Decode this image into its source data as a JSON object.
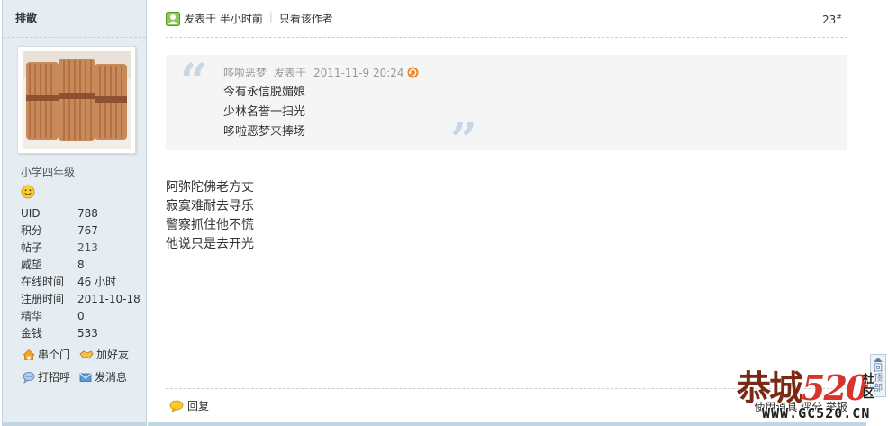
{
  "author": {
    "name": "排散",
    "group": "小学四年级",
    "stats": [
      {
        "label": "UID",
        "value": "788"
      },
      {
        "label": "积分",
        "value": "767"
      },
      {
        "label": "帖子",
        "value": "213"
      },
      {
        "label": "威望",
        "value": "8"
      },
      {
        "label": "在线时间",
        "value": "46 小时"
      },
      {
        "label": "注册时间",
        "value": "2011-10-18"
      },
      {
        "label": "精华",
        "value": "0"
      },
      {
        "label": "金钱",
        "value": "533"
      }
    ],
    "actions": {
      "visit": "串个门",
      "add_friend": "加好友",
      "poke": "打招呼",
      "message": "发消息"
    }
  },
  "post": {
    "posted_label": "发表于",
    "posted_time": "半小时前",
    "only_author": "只看该作者",
    "floor": "23",
    "floor_sup": "#",
    "quote": {
      "author": "哆啦恶梦",
      "posted_label": "发表于",
      "date": "2011-11-9 20:24",
      "lines": [
        "今有永信脱媚娘",
        "少林名誉一扫光",
        "哆啦恶梦来捧场"
      ]
    },
    "body_lines": [
      "阿弥陀佛老方丈",
      "寂寞难耐去寻乐",
      "警察抓住他不慌",
      "他说只是去开光"
    ],
    "reply_label": "回复",
    "footer_right": "使用道具   评分   举报"
  },
  "totop": {
    "label": "回顶部"
  },
  "watermark": {
    "brand_a": "恭城",
    "brand_num": "520",
    "brand_side": "社区",
    "url": "WWW.GC520.CN"
  },
  "colors": {
    "side_bg": "#e5edf2",
    "border": "#c2d5e3",
    "quote_bg": "#f5f5f5",
    "watermark_red": "#d9342a"
  }
}
